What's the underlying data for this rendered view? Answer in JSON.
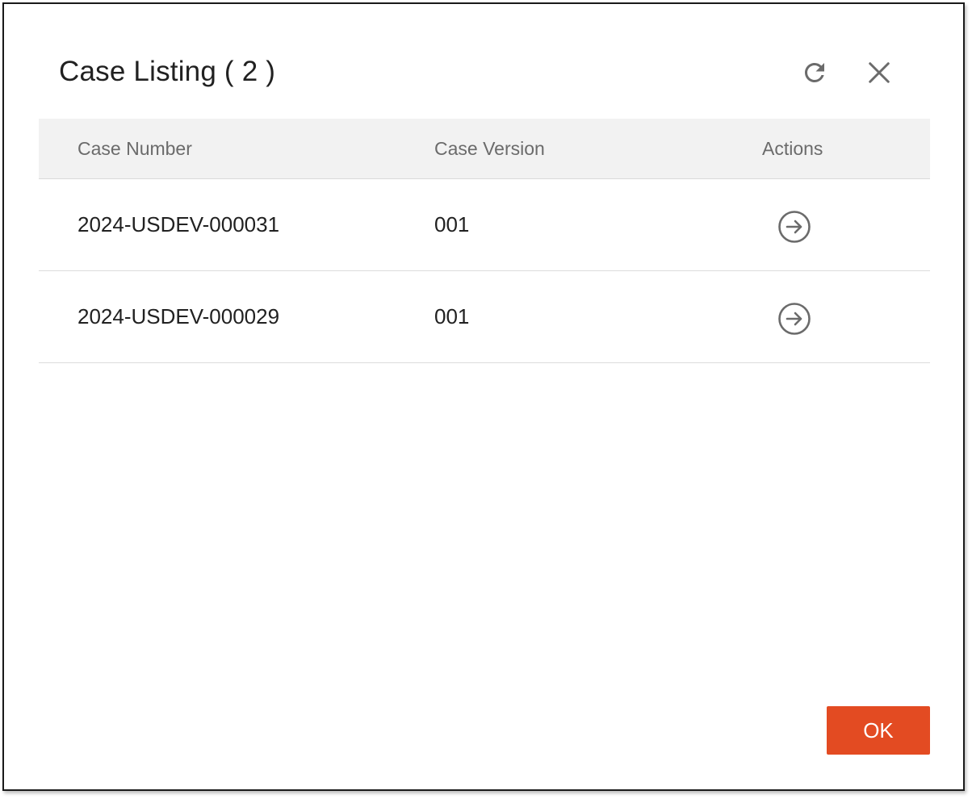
{
  "dialog": {
    "title": "Case Listing ( 2 )",
    "refresh_icon": "refresh-icon",
    "close_icon": "close-icon"
  },
  "table": {
    "headers": [
      "Case Number",
      "Case Version",
      "Actions"
    ],
    "rows": [
      {
        "case_number": "2024-USDEV-000031",
        "case_version": "001",
        "action_icon": "arrow-right-circle-icon"
      },
      {
        "case_number": "2024-USDEV-000029",
        "case_version": "001",
        "action_icon": "arrow-right-circle-icon"
      }
    ]
  },
  "footer": {
    "ok_label": "OK"
  },
  "colors": {
    "accent": "#e34b22",
    "header_bg": "#f2f2f2",
    "icon": "#6b6b6b"
  }
}
